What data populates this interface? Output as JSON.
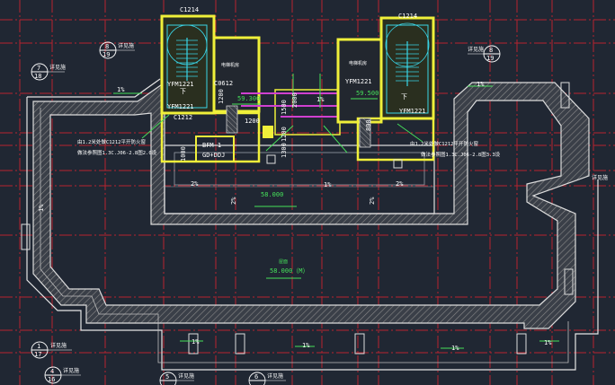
{
  "colors": {
    "background": "#202733",
    "grid_red": "#c8232f",
    "wall_yellow": "#f0f03a",
    "parapet_gray": "#d8d8d8",
    "hatch": "#8a8a8a",
    "text_green": "#46e05a",
    "cyan": "#39d4e6",
    "magenta": "#d040d0"
  },
  "labels": {
    "window_top_left": "C1214",
    "window_top_right": "C1214",
    "door_left_a": "YFM1221",
    "door_left_b": "C0612",
    "door_left_c": "YFM1221",
    "door_right_a": "YFM1221",
    "door_right_b": "YFM1221",
    "window_left_small": "C1212",
    "blast_door": "BFM-1",
    "blast_door_sub": "GD+DDJ",
    "down_left": "下",
    "down_right": "下",
    "room_left": "电梯机房",
    "room_right": "电梯机房",
    "elev_left": "59.300",
    "elev_right": "59.500",
    "elev_roof": "58.000",
    "elev_floor": "58.000（M）",
    "floor_note": "屋面",
    "dim_1200_a": "1200",
    "dim_1200_b": "1200",
    "dim_1200_c": "1200",
    "dim_1500": "1500",
    "dim_2000": "2000",
    "dim_1300": "1300",
    "dim_800": "800",
    "dim_1000": "1000",
    "note_left_1": "由1.2米处做C1212平开防火窗",
    "note_left_2": "做法参照图1.3C.J06-2.8图2.0设",
    "note_right_1": "由1.2米处做C1212平开防火窗",
    "note_right_2": "做法参照图1.3C.J06-2.8图3.3设",
    "slope_labels": [
      "1%",
      "1%",
      "1%",
      "1%",
      "2%",
      "2%",
      "2%",
      "2%",
      "1%",
      "1%",
      "1%",
      "1%",
      "1%"
    ],
    "callouts": [
      {
        "top": "8",
        "bottom": "19",
        "text": "详见施"
      },
      {
        "top": "7",
        "bottom": "18",
        "text": "详见施"
      },
      {
        "top": "8",
        "bottom": "19",
        "text": "详见施"
      },
      {
        "top": "1",
        "bottom": "17",
        "text": "详见施"
      },
      {
        "top": "4",
        "bottom": "16",
        "text": "详见施"
      },
      {
        "top": "5",
        "bottom": "19",
        "text": "详见施"
      },
      {
        "top": "6",
        "bottom": "19",
        "text": "详见施"
      }
    ],
    "callout_right": "详见施"
  }
}
